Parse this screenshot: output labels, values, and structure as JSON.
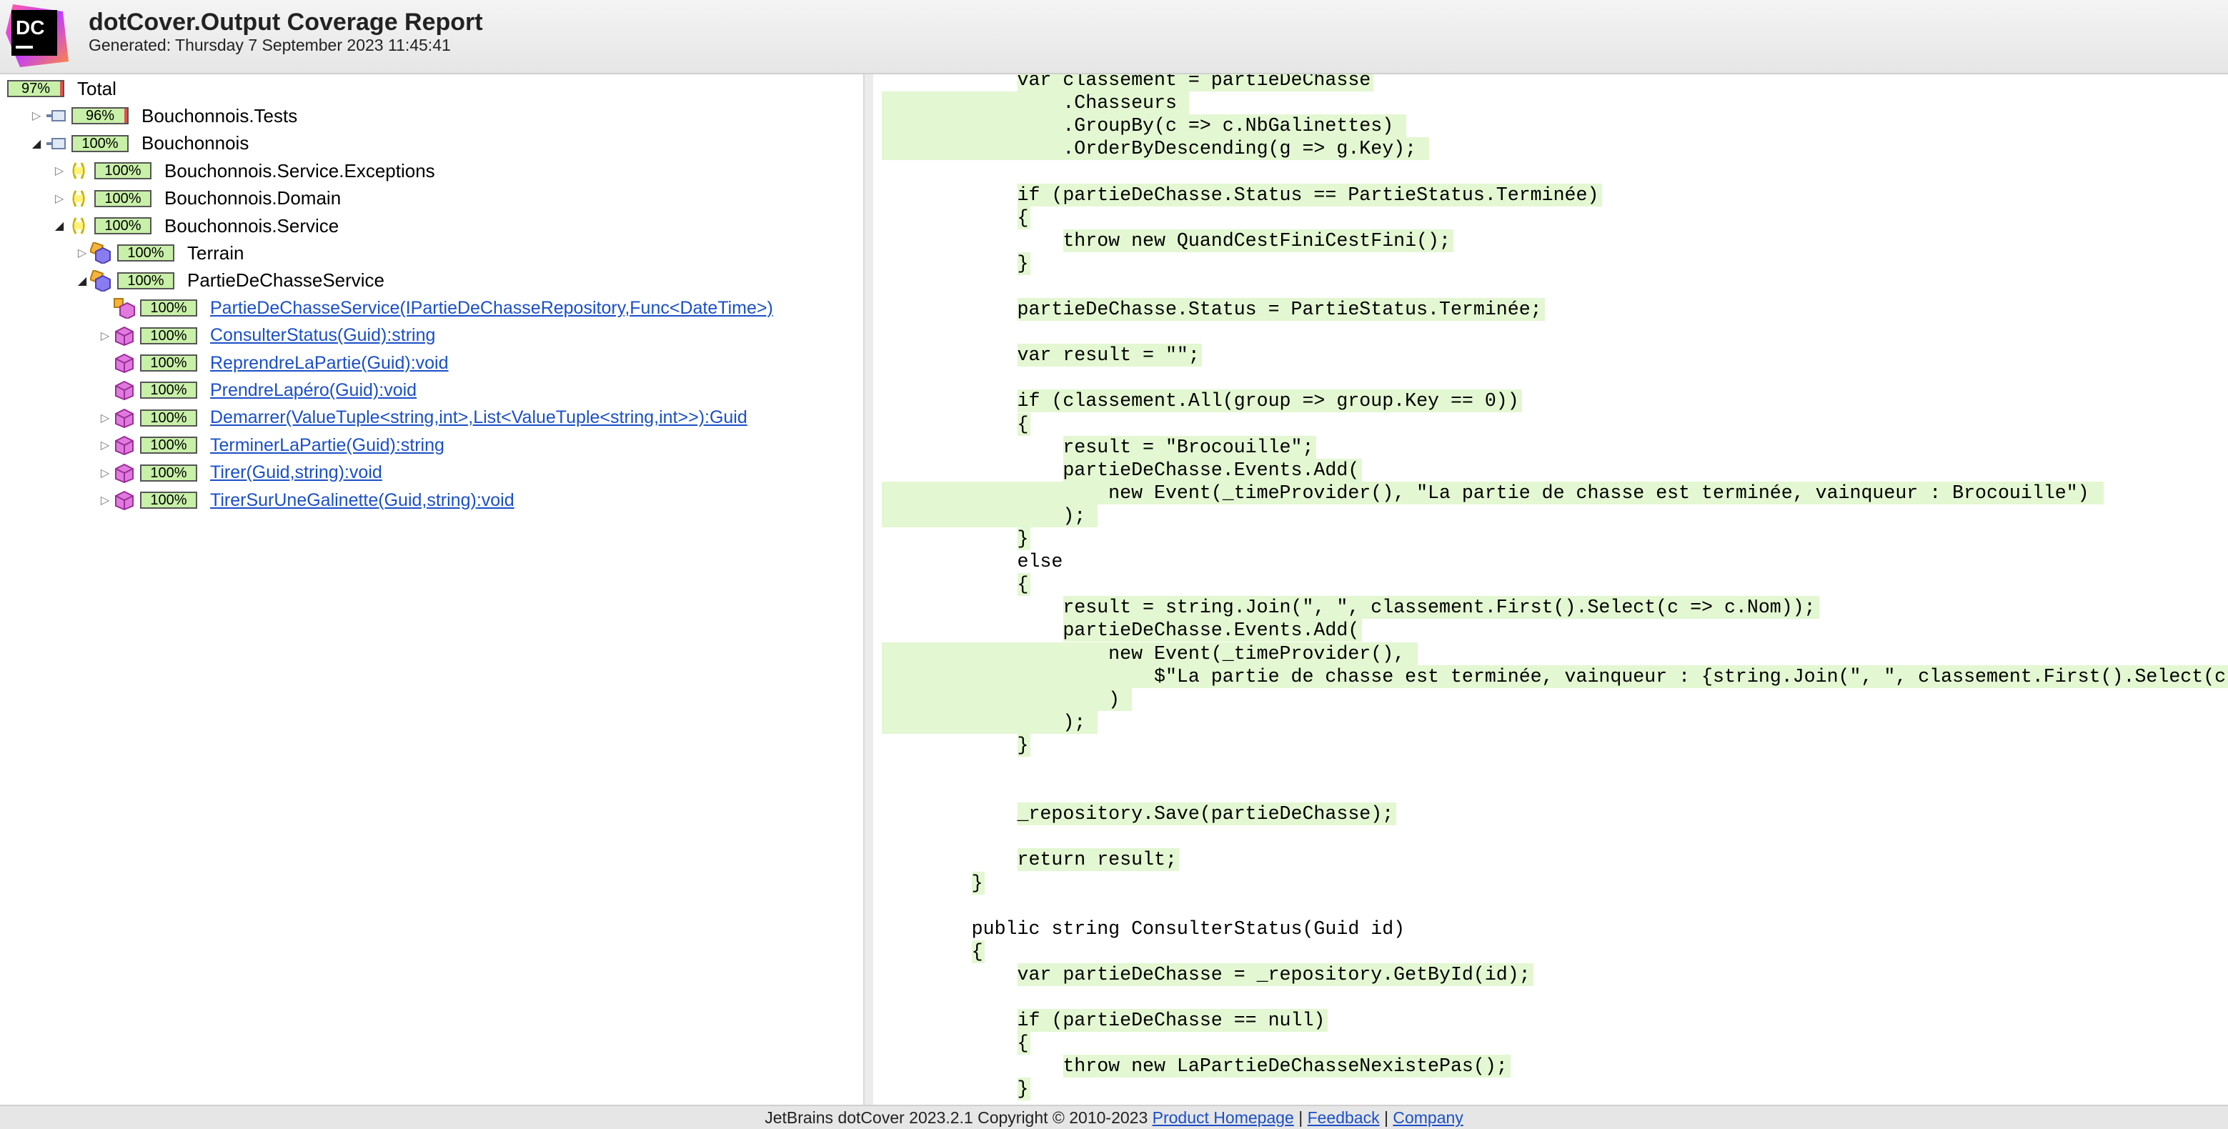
{
  "header": {
    "logo_text": "DC",
    "title": "dotCover.Output Coverage Report",
    "generated": "Generated: Thursday 7 September 2023 11:45:41"
  },
  "tree": [
    {
      "level": 0,
      "expander": "none",
      "icon": "none",
      "coverage": "97%",
      "label": "Total",
      "link": false,
      "partial": true
    },
    {
      "level": 1,
      "expander": "collapsed",
      "icon": "assembly-icon",
      "coverage": "96%",
      "label": "Bouchonnois.Tests",
      "link": false,
      "partial": true
    },
    {
      "level": 1,
      "expander": "expanded",
      "icon": "assembly-icon",
      "coverage": "100%",
      "label": "Bouchonnois",
      "link": false
    },
    {
      "level": 2,
      "expander": "collapsed",
      "icon": "namespace-icon",
      "coverage": "100%",
      "label": "Bouchonnois.Service.Exceptions",
      "link": false
    },
    {
      "level": 2,
      "expander": "collapsed",
      "icon": "namespace-icon",
      "coverage": "100%",
      "label": "Bouchonnois.Domain",
      "link": false
    },
    {
      "level": 2,
      "expander": "expanded",
      "icon": "namespace-icon",
      "coverage": "100%",
      "label": "Bouchonnois.Service",
      "link": false
    },
    {
      "level": 3,
      "expander": "collapsed",
      "icon": "class-icon",
      "coverage": "100%",
      "label": "Terrain",
      "link": false
    },
    {
      "level": 3,
      "expander": "expanded",
      "icon": "class-icon",
      "coverage": "100%",
      "label": "PartieDeChasseService",
      "link": false
    },
    {
      "level": 4,
      "expander": "none",
      "icon": "constructor-icon",
      "coverage": "100%",
      "label": "PartieDeChasseService(IPartieDeChasseRepository,Func<DateTime>)",
      "link": true
    },
    {
      "level": 4,
      "expander": "collapsed",
      "icon": "method-icon",
      "coverage": "100%",
      "label": "ConsulterStatus(Guid):string",
      "link": true
    },
    {
      "level": 4,
      "expander": "none",
      "icon": "method-icon",
      "coverage": "100%",
      "label": "ReprendreLaPartie(Guid):void",
      "link": true
    },
    {
      "level": 4,
      "expander": "none",
      "icon": "method-icon",
      "coverage": "100%",
      "label": "PrendreLapéro(Guid):void",
      "link": true
    },
    {
      "level": 4,
      "expander": "collapsed",
      "icon": "method-icon",
      "coverage": "100%",
      "label": "Demarrer(ValueTuple<string,int>,List<ValueTuple<string,int>>):Guid",
      "link": true
    },
    {
      "level": 4,
      "expander": "collapsed",
      "icon": "method-icon",
      "coverage": "100%",
      "label": "TerminerLaPartie(Guid):string",
      "link": true
    },
    {
      "level": 4,
      "expander": "collapsed",
      "icon": "method-icon",
      "coverage": "100%",
      "label": "Tirer(Guid,string):void",
      "link": true
    },
    {
      "level": 4,
      "expander": "collapsed",
      "icon": "method-icon",
      "coverage": "100%",
      "label": "TirerSurUneGalinette(Guid,string):void",
      "link": true
    }
  ],
  "code_lines": [
    {
      "text": "            var classement = partieDeChasse",
      "hl": "text"
    },
    {
      "text": "                .Chasseurs",
      "hl": "full"
    },
    {
      "text": "                .GroupBy(c => c.NbGalinettes)",
      "hl": "full"
    },
    {
      "text": "                .OrderByDescending(g => g.Key);",
      "hl": "full"
    },
    {
      "text": "",
      "hl": "none"
    },
    {
      "text": "            if (partieDeChasse.Status == PartieStatus.Terminée)",
      "hl": "text"
    },
    {
      "text": "            {",
      "hl": "text"
    },
    {
      "text": "                throw new QuandCestFiniCestFini();",
      "hl": "text"
    },
    {
      "text": "            }",
      "hl": "text"
    },
    {
      "text": "",
      "hl": "none"
    },
    {
      "text": "            partieDeChasse.Status = PartieStatus.Terminée;",
      "hl": "text"
    },
    {
      "text": "",
      "hl": "none"
    },
    {
      "text": "            var result = \"\";",
      "hl": "text"
    },
    {
      "text": "",
      "hl": "none"
    },
    {
      "text": "            if (classement.All(group => group.Key == 0))",
      "hl": "text"
    },
    {
      "text": "            {",
      "hl": "text"
    },
    {
      "text": "                result = \"Brocouille\";",
      "hl": "text"
    },
    {
      "text": "                partieDeChasse.Events.Add(",
      "hl": "text"
    },
    {
      "text": "                    new Event(_timeProvider(), \"La partie de chasse est terminée, vainqueur : Brocouille\")",
      "hl": "full"
    },
    {
      "text": "                );",
      "hl": "full"
    },
    {
      "text": "            }",
      "hl": "text"
    },
    {
      "text": "            else",
      "hl": "none"
    },
    {
      "text": "            {",
      "hl": "text"
    },
    {
      "text": "                result = string.Join(\", \", classement.First().Select(c => c.Nom));",
      "hl": "text"
    },
    {
      "text": "                partieDeChasse.Events.Add(",
      "hl": "text"
    },
    {
      "text": "                    new Event(_timeProvider(),",
      "hl": "full"
    },
    {
      "text": "                        $\"La partie de chasse est terminée, vainqueur : {string.Join(\", \", classement.First().Select(c => c.Nom))}\"",
      "hl": "full"
    },
    {
      "text": "                    )",
      "hl": "full"
    },
    {
      "text": "                );",
      "hl": "full"
    },
    {
      "text": "            }",
      "hl": "text"
    },
    {
      "text": "",
      "hl": "none"
    },
    {
      "text": "",
      "hl": "none"
    },
    {
      "text": "            _repository.Save(partieDeChasse);",
      "hl": "text"
    },
    {
      "text": "",
      "hl": "none"
    },
    {
      "text": "            return result;",
      "hl": "text"
    },
    {
      "text": "        }",
      "hl": "text"
    },
    {
      "text": "",
      "hl": "none"
    },
    {
      "text": "        public string ConsulterStatus(Guid id)",
      "hl": "none"
    },
    {
      "text": "        {",
      "hl": "text"
    },
    {
      "text": "            var partieDeChasse = _repository.GetById(id);",
      "hl": "text"
    },
    {
      "text": "",
      "hl": "none"
    },
    {
      "text": "            if (partieDeChasse == null)",
      "hl": "text"
    },
    {
      "text": "            {",
      "hl": "text"
    },
    {
      "text": "                throw new LaPartieDeChasseNexistePas();",
      "hl": "text"
    },
    {
      "text": "            }",
      "hl": "text"
    }
  ],
  "footer": {
    "text": "JetBrains dotCover 2023.2.1 Copyright © 2010-2023 ",
    "link_homepage": "Product Homepage",
    "sep1": " | ",
    "link_feedback": "Feedback",
    "sep2": " | ",
    "link_company": "Company"
  },
  "colors": {
    "covered_badge": "#c8f0a8",
    "covered_code": "#e3f7d2",
    "link": "#1a4fc8",
    "uncovered_marker": "#e05050"
  }
}
